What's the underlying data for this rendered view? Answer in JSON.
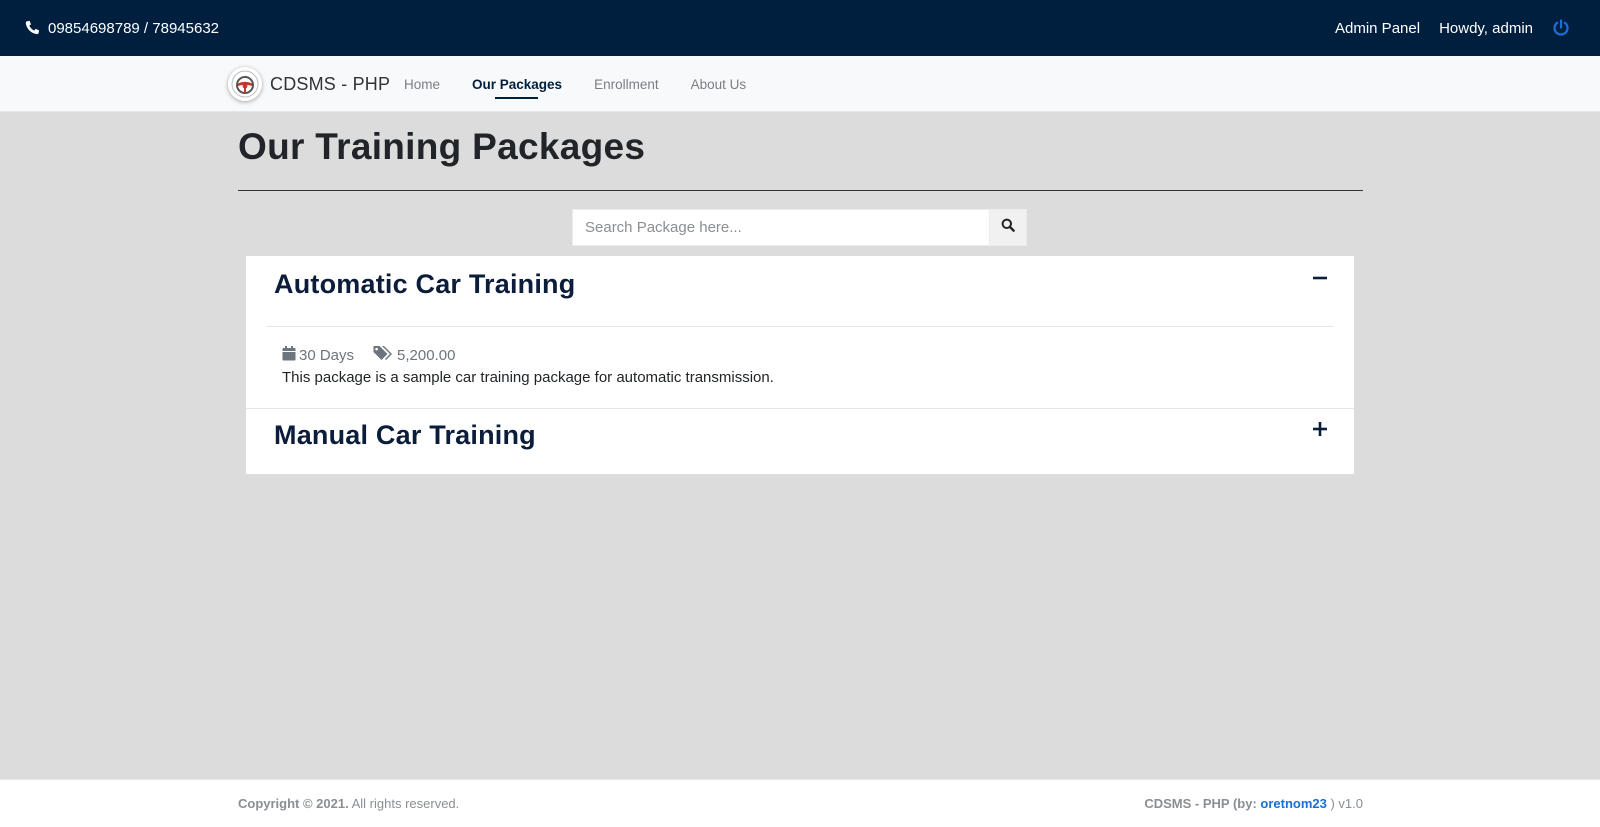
{
  "topbar": {
    "phone": "09854698789 / 78945632",
    "admin_panel_label": "Admin Panel",
    "greeting": "Howdy, admin",
    "phone_icon": "phone-icon",
    "logout_icon": "power-icon",
    "background_color": "#001f3f",
    "accent_color": "#1a6fd6"
  },
  "navbar": {
    "brand_name": "CDSMS - PHP",
    "logo_icon": "steering-wheel-logo",
    "links": [
      {
        "label": "Home",
        "active": false
      },
      {
        "label": "Our Packages",
        "active": true
      },
      {
        "label": "Enrollment",
        "active": false
      },
      {
        "label": "About Us",
        "active": false
      }
    ]
  },
  "main": {
    "title": "Our Training Packages",
    "search": {
      "placeholder": "Search Package here...",
      "value": "",
      "button_icon": "search-icon"
    },
    "packages": [
      {
        "title": "Automatic Car Training",
        "expanded": true,
        "toggle_icon": "minus-icon",
        "duration": "30 Days",
        "duration_icon": "calendar-icon",
        "price": "5,200.00",
        "price_icon": "tags-icon",
        "description": "This package is a sample car training package for automatic transmission."
      },
      {
        "title": "Manual Car Training",
        "expanded": false,
        "toggle_icon": "plus-icon"
      }
    ]
  },
  "footer": {
    "copyright_bold": "Copyright © 2021.",
    "copyright_rest": " All rights reserved.",
    "credit_prefix": "CDSMS - PHP (by: ",
    "credit_author": "oretnom23",
    "credit_suffix": " ) v1.0"
  }
}
